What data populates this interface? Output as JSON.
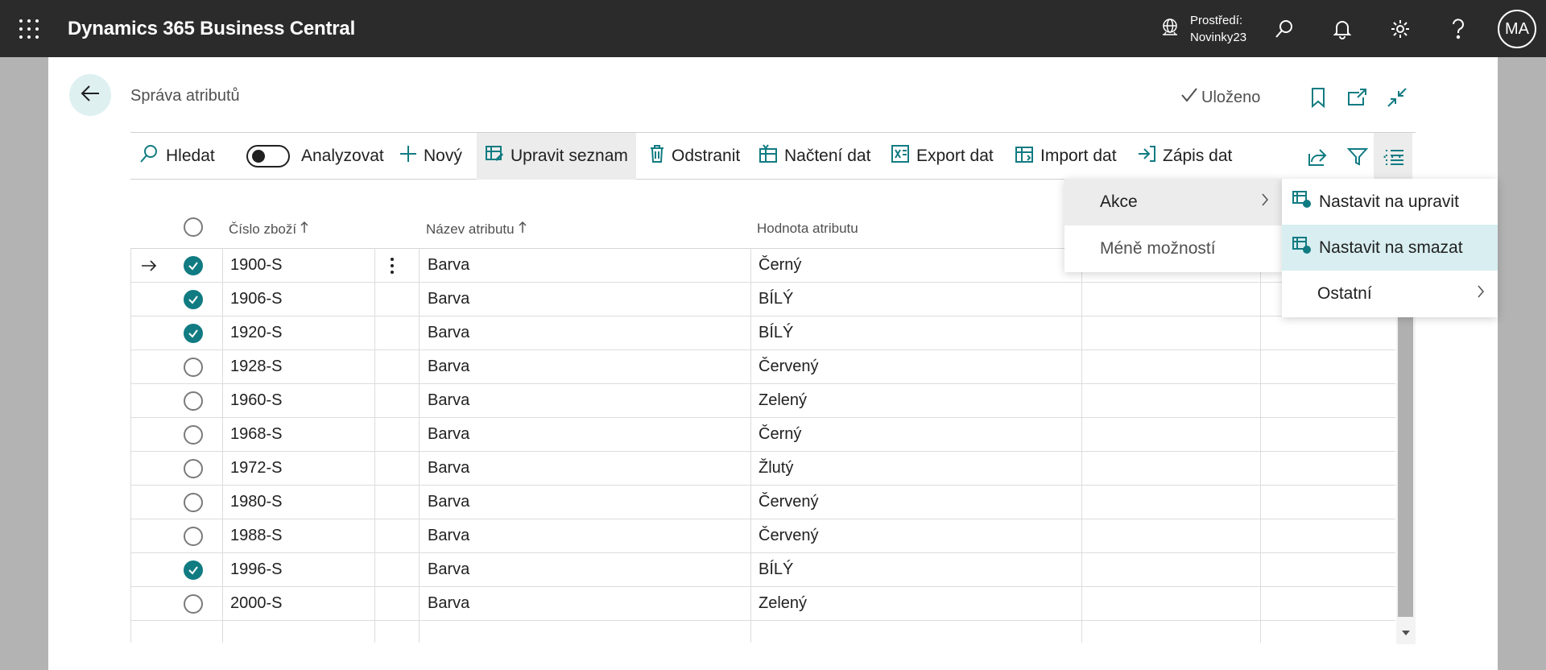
{
  "topbar": {
    "app_title": "Dynamics 365 Business Central",
    "env_label": "Prostředí:",
    "env_name": "Novinky23",
    "avatar_initials": "MA"
  },
  "header": {
    "page_title": "Správa atributů",
    "saved_label": "Uloženo"
  },
  "actions": {
    "search": "Hledat",
    "analyze": "Analyzovat",
    "new": "Nový",
    "edit_list": "Upravit seznam",
    "delete": "Odstranit",
    "load_data": "Načtení dat",
    "export_data": "Export dat",
    "import_data": "Import dat",
    "write_data": "Zápis dat",
    "more": "···"
  },
  "columns": {
    "item_no": "Číslo zboží",
    "attribute_name": "Název atributu",
    "attribute_value": "Hodnota atributu"
  },
  "rows": [
    {
      "item_no": "1900-S",
      "attribute": "Barva",
      "value": "Černý",
      "checked": true,
      "current": true
    },
    {
      "item_no": "1906-S",
      "attribute": "Barva",
      "value": "BÍLÝ",
      "checked": true
    },
    {
      "item_no": "1920-S",
      "attribute": "Barva",
      "value": "BÍLÝ",
      "checked": true
    },
    {
      "item_no": "1928-S",
      "attribute": "Barva",
      "value": "Červený",
      "checked": false
    },
    {
      "item_no": "1960-S",
      "attribute": "Barva",
      "value": "Zelený",
      "checked": false
    },
    {
      "item_no": "1968-S",
      "attribute": "Barva",
      "value": "Černý",
      "checked": false
    },
    {
      "item_no": "1972-S",
      "attribute": "Barva",
      "value": "Žlutý",
      "checked": false
    },
    {
      "item_no": "1980-S",
      "attribute": "Barva",
      "value": "Červený",
      "checked": false
    },
    {
      "item_no": "1988-S",
      "attribute": "Barva",
      "value": "Červený",
      "checked": false
    },
    {
      "item_no": "1996-S",
      "attribute": "Barva",
      "value": "BÍLÝ",
      "checked": true
    },
    {
      "item_no": "2000-S",
      "attribute": "Barva",
      "value": "Zelený",
      "checked": false
    }
  ],
  "menu_more": {
    "actions": "Akce",
    "fewer_options": "Méně možností"
  },
  "menu_actions": {
    "set_to_edit": "Nastavit na upravit",
    "set_to_delete": "Nastavit na smazat",
    "other": "Ostatní"
  },
  "colors": {
    "accent": "#117b82",
    "topbar": "#2b2b2b",
    "highlight": "#d8eef0"
  }
}
